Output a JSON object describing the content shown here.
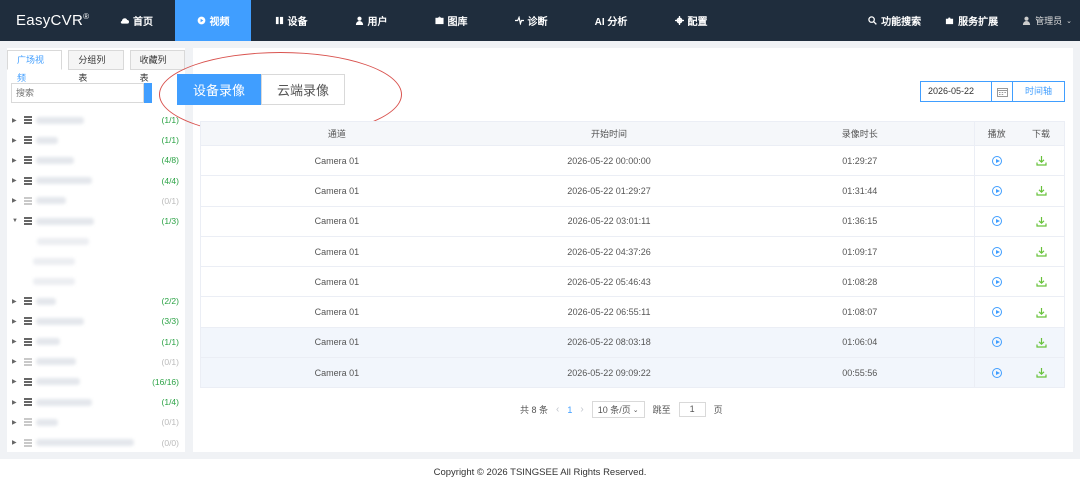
{
  "app": {
    "logo": "EasyCVR",
    "logo_mark": "®"
  },
  "nav": {
    "items": [
      {
        "label": "首页",
        "icon": "cloud-icon",
        "active": false,
        "width": 77
      },
      {
        "label": "视频",
        "icon": "play-circle-icon",
        "active": true,
        "width": 76
      },
      {
        "label": "设备",
        "icon": "device-icon",
        "active": false,
        "width": 80
      },
      {
        "label": "用户",
        "icon": "user-icon",
        "active": false,
        "width": 80
      },
      {
        "label": "图库",
        "icon": "gallery-icon",
        "active": false,
        "width": 80
      },
      {
        "label": "诊断",
        "icon": "pulse-icon",
        "active": false,
        "width": 80
      },
      {
        "label": "AI 分析",
        "icon": "",
        "active": false,
        "width": 80
      },
      {
        "label": "配置",
        "icon": "gear-icon",
        "active": false,
        "width": 80
      }
    ],
    "feature_search": "功能搜索",
    "service_ext": "服务扩展",
    "user": "管理员"
  },
  "sidebar": {
    "tabs": [
      "广场视频",
      "分组列表",
      "收藏列表"
    ],
    "search_placeholder": "搜索",
    "tree": [
      {
        "count": "(1/1)",
        "dim": false,
        "expanded": false,
        "w": 48
      },
      {
        "count": "(1/1)",
        "dim": false,
        "expanded": false,
        "w": 22
      },
      {
        "count": "(4/8)",
        "dim": false,
        "expanded": false,
        "w": 38
      },
      {
        "count": "(4/4)",
        "dim": false,
        "expanded": false,
        "w": 56
      },
      {
        "count": "(0/1)",
        "dim": true,
        "expanded": false,
        "w": 30
      },
      {
        "count": "(1/3)",
        "dim": false,
        "expanded": true,
        "w": 58
      },
      {
        "count": "(2/2)",
        "dim": false,
        "expanded": false,
        "w": 20
      },
      {
        "count": "(3/3)",
        "dim": false,
        "expanded": false,
        "w": 48
      },
      {
        "count": "(1/1)",
        "dim": false,
        "expanded": false,
        "w": 24
      },
      {
        "count": "(0/1)",
        "dim": true,
        "expanded": false,
        "w": 40
      },
      {
        "count": "(16/16)",
        "dim": false,
        "expanded": false,
        "w": 44
      },
      {
        "count": "(1/4)",
        "dim": false,
        "expanded": false,
        "w": 56
      },
      {
        "count": "(0/1)",
        "dim": true,
        "expanded": false,
        "w": 22
      },
      {
        "count": "(0/0)",
        "dim": true,
        "expanded": false,
        "w": 98
      }
    ]
  },
  "recording": {
    "tabs": [
      "设备录像",
      "云端录像"
    ],
    "active_tab": "设备录像",
    "date": "2026-05-22",
    "timeline_label": "时间轴",
    "columns": [
      "通道",
      "开始时间",
      "录像时长",
      "播放",
      "下载"
    ],
    "rows": [
      {
        "channel": "Camera 01",
        "start": "2026-05-22 00:00:00",
        "duration": "01:29:27"
      },
      {
        "channel": "Camera 01",
        "start": "2026-05-22 01:29:27",
        "duration": "01:31:44"
      },
      {
        "channel": "Camera 01",
        "start": "2026-05-22 03:01:11",
        "duration": "01:36:15"
      },
      {
        "channel": "Camera 01",
        "start": "2026-05-22 04:37:26",
        "duration": "01:09:17"
      },
      {
        "channel": "Camera 01",
        "start": "2026-05-22 05:46:43",
        "duration": "01:08:28"
      },
      {
        "channel": "Camera 01",
        "start": "2026-05-22 06:55:11",
        "duration": "01:08:07"
      },
      {
        "channel": "Camera 01",
        "start": "2026-05-22 08:03:18",
        "duration": "01:06:04"
      },
      {
        "channel": "Camera 01",
        "start": "2026-05-22 09:09:22",
        "duration": "00:55:56"
      }
    ],
    "highlighted_rows": [
      6,
      7
    ]
  },
  "pager": {
    "total": "共 8 条",
    "page": "1",
    "page_size": "10 条/页",
    "goto_label": "跳至",
    "goto_value": "1",
    "page_suffix": "页"
  },
  "footer": "Copyright © 2026 TSINGSEE All Rights Reserved.",
  "colors": {
    "accent": "#409eff",
    "nav_bg": "#1f2d3d",
    "online": "#2ba245",
    "annotation": "#d9534f"
  }
}
